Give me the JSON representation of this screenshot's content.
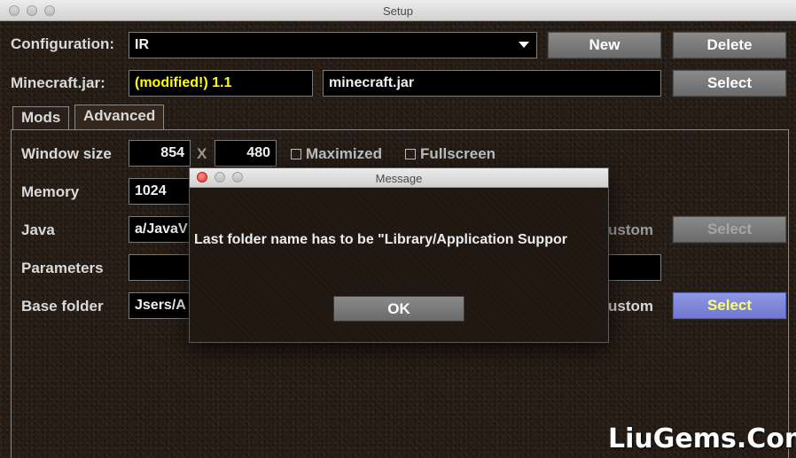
{
  "window": {
    "title": "Setup"
  },
  "config": {
    "configuration_label": "Configuration:",
    "configuration_value": "IR",
    "new_label": "New",
    "delete_label": "Delete",
    "minecraft_jar_label": "Minecraft.jar:",
    "jar_version": "(modified!) 1.1",
    "jar_filename": "minecraft.jar",
    "select_label": "Select"
  },
  "tabs": [
    {
      "label": "Mods"
    },
    {
      "label": "Advanced"
    }
  ],
  "advanced": {
    "window_size_label": "Window size",
    "width_value": "854",
    "x_separator": "X",
    "height_value": "480",
    "maximized_label": "Maximized",
    "fullscreen_label": "Fullscreen",
    "memory_label": "Memory",
    "memory_value": "1024",
    "java_label": "Java",
    "java_value": "a/JavaV",
    "java_custom_label": "ustom",
    "java_select_label": "Select",
    "parameters_label": "Parameters",
    "parameters_value": "",
    "base_folder_label": "Base folder",
    "base_folder_value": "Jsers/A",
    "base_custom_label": "ustom",
    "base_select_label": "Select"
  },
  "dialog": {
    "title": "Message",
    "message": "Last folder name has to be \"Library/Application Suppor",
    "ok_label": "OK"
  },
  "watermark": "LiuGems.Com",
  "colors": {
    "jar_version_text": "#ffff00",
    "active_select_bg": "#7f88dd",
    "active_select_text": "#ffff66"
  }
}
